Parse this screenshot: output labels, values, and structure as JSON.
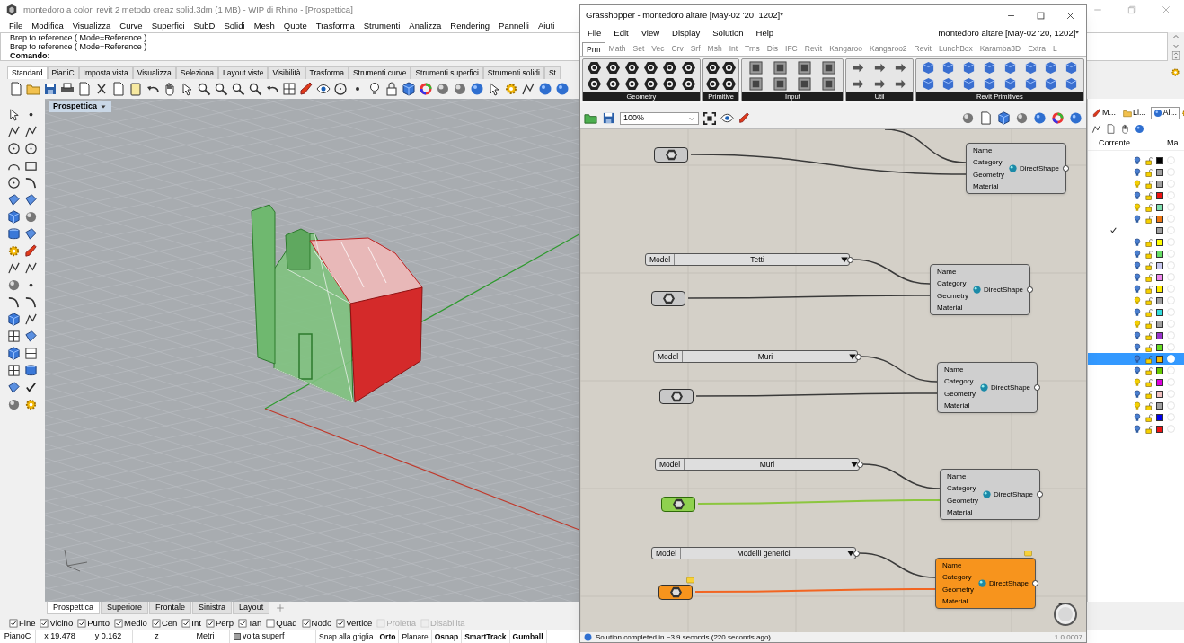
{
  "rhino": {
    "title": "montedoro a colori revit 2 metodo creaz solid.3dm (1 MB) - WIP di Rhino - [Prospettica]",
    "menu": [
      "File",
      "Modifica",
      "Visualizza",
      "Curve",
      "Superfici",
      "SubD",
      "Solidi",
      "Mesh",
      "Quote",
      "Trasforma",
      "Strumenti",
      "Analizza",
      "Rendering",
      "Pannelli",
      "Aiuti"
    ],
    "command_history": [
      "Brep to reference ( Mode=Reference )",
      "Brep to reference ( Mode=Reference )"
    ],
    "command_prompt": "Comando:",
    "toolbar_tabs": [
      {
        "label": "Standard",
        "selected": true
      },
      {
        "label": "PianiC",
        "selected": false
      },
      {
        "label": "Imposta vista",
        "selected": false
      },
      {
        "label": "Visualizza",
        "selected": false
      },
      {
        "label": "Seleziona",
        "selected": false
      },
      {
        "label": "Layout viste",
        "selected": false
      },
      {
        "label": "Visibilità",
        "selected": false
      },
      {
        "label": "Trasforma",
        "selected": false
      },
      {
        "label": "Strumenti curve",
        "selected": false
      },
      {
        "label": "Strumenti superfici",
        "selected": false
      },
      {
        "label": "Strumenti solidi",
        "selected": false
      },
      {
        "label": "St",
        "selected": false
      }
    ],
    "viewport": {
      "label": "Prospettica"
    },
    "viewport_tabs": [
      {
        "label": "Prospettica",
        "selected": true
      },
      {
        "label": "Superiore",
        "selected": false
      },
      {
        "label": "Frontale",
        "selected": false
      },
      {
        "label": "Sinistra",
        "selected": false
      },
      {
        "label": "Layout",
        "selected": false
      }
    ],
    "osnaps": [
      {
        "label": "Fine",
        "checked": true,
        "disabled": false
      },
      {
        "label": "Vicino",
        "checked": true,
        "disabled": false
      },
      {
        "label": "Punto",
        "checked": true,
        "disabled": false
      },
      {
        "label": "Medio",
        "checked": true,
        "disabled": false
      },
      {
        "label": "Cen",
        "checked": true,
        "disabled": false
      },
      {
        "label": "Int",
        "checked": true,
        "disabled": false
      },
      {
        "label": "Perp",
        "checked": true,
        "disabled": false
      },
      {
        "label": "Tan",
        "checked": true,
        "disabled": false
      },
      {
        "label": "Quad",
        "checked": false,
        "disabled": false
      },
      {
        "label": "Nodo",
        "checked": true,
        "disabled": false
      },
      {
        "label": "Vertice",
        "checked": true,
        "disabled": false
      },
      {
        "label": "Proietta",
        "checked": false,
        "disabled": true
      },
      {
        "label": "Disabilita",
        "checked": false,
        "disabled": true
      }
    ],
    "status_bar": [
      {
        "kind": "field",
        "label": "PianoC"
      },
      {
        "kind": "field",
        "label": "x 19.478"
      },
      {
        "kind": "field",
        "label": "y 0.162"
      },
      {
        "kind": "field",
        "label": "z"
      },
      {
        "kind": "field",
        "label": "Metri"
      },
      {
        "kind": "layer",
        "label": "volta superf"
      },
      {
        "kind": "toggle",
        "label": "Snap alla griglia",
        "on": false
      },
      {
        "kind": "toggle",
        "label": "Orto",
        "on": true
      },
      {
        "kind": "toggle",
        "label": "Planare",
        "on": false
      },
      {
        "kind": "toggle",
        "label": "Osnap",
        "on": true
      },
      {
        "kind": "toggle",
        "label": "SmartTrack",
        "on": true
      },
      {
        "kind": "toggle",
        "label": "Gumball",
        "on": true
      }
    ]
  },
  "grasshopper": {
    "title": "Grasshopper - montedoro altare [May-02 '20, 1202]*",
    "menu": [
      "File",
      "Edit",
      "View",
      "Display",
      "Solution",
      "Help"
    ],
    "document_name": "montedoro altare [May-02 '20, 1202]*",
    "tabs": [
      {
        "label": "Prm",
        "selected": true
      },
      {
        "label": "Math",
        "selected": false
      },
      {
        "label": "Set",
        "selected": false
      },
      {
        "label": "Vec",
        "selected": false
      },
      {
        "label": "Crv",
        "selected": false
      },
      {
        "label": "Srf",
        "selected": false
      },
      {
        "label": "Msh",
        "selected": false
      },
      {
        "label": "Int",
        "selected": false
      },
      {
        "label": "Trns",
        "selected": false
      },
      {
        "label": "Dis",
        "selected": false
      },
      {
        "label": "IFC",
        "selected": false
      },
      {
        "label": "Revit",
        "selected": false
      },
      {
        "label": "Kangaroo",
        "selected": false
      },
      {
        "label": "Kangaroo2",
        "selected": false
      },
      {
        "label": "Revit",
        "selected": false
      },
      {
        "label": "LunchBox",
        "selected": false
      },
      {
        "label": "Karamba3D",
        "selected": false
      },
      {
        "label": "Extra",
        "selected": false
      },
      {
        "label": "L",
        "selected": false
      }
    ],
    "ribbon_groups": [
      "Geometry",
      "Primitive",
      "Input",
      "Util",
      "Revit Primitives"
    ],
    "zoom": "100%",
    "components": [
      {
        "param": {
          "selected": false,
          "warning": false
        },
        "warning": false,
        "title": "DirectShape",
        "inputs": [
          "Name",
          "Category",
          "Geometry",
          "Material"
        ]
      },
      {
        "value_list": {
          "label": "Model",
          "value": "Tetti"
        },
        "param": {
          "selected": false,
          "warning": false
        },
        "warning": false,
        "title": "DirectShape",
        "inputs": [
          "Name",
          "Category",
          "Geometry",
          "Material"
        ]
      },
      {
        "value_list": {
          "label": "Model",
          "value": "Muri"
        },
        "param": {
          "selected": false,
          "warning": false
        },
        "warning": false,
        "title": "DirectShape",
        "inputs": [
          "Name",
          "Category",
          "Geometry",
          "Material"
        ]
      },
      {
        "value_list": {
          "label": "Model",
          "value": "Muri"
        },
        "param": {
          "selected": true,
          "warning": false
        },
        "warning": false,
        "title": "DirectShape",
        "inputs": [
          "Name",
          "Category",
          "Geometry",
          "Material"
        ]
      },
      {
        "value_list": {
          "label": "Model",
          "value": "Modelli generici"
        },
        "param": {
          "selected": false,
          "warning": true
        },
        "warning": true,
        "title": "DirectShape",
        "inputs": [
          "Name",
          "Category",
          "Geometry",
          "Material"
        ]
      }
    ],
    "status": "Solution completed in ~3.9 seconds (220 seconds ago)",
    "version": "1.0.0007"
  },
  "layers": {
    "tabs": [
      {
        "label": "M...",
        "selected": false
      },
      {
        "label": "Li...",
        "selected": false
      },
      {
        "label": "Ai...",
        "selected": true
      }
    ],
    "columns": [
      "Corrente",
      "Ma"
    ],
    "rows": [
      {
        "current": false,
        "lit": false,
        "color": "#000000",
        "selected": false
      },
      {
        "current": false,
        "lit": false,
        "color": "#a0a0a0",
        "selected": false
      },
      {
        "current": false,
        "lit": true,
        "color": "#a0a0a0",
        "selected": false
      },
      {
        "current": false,
        "lit": false,
        "color": "#ee1111",
        "selected": false
      },
      {
        "current": false,
        "lit": true,
        "color": "#80e0b0",
        "selected": false
      },
      {
        "current": false,
        "lit": false,
        "color": "#ee7711",
        "selected": false
      },
      {
        "current": true,
        "color": "#a0a0a0",
        "selected": false
      },
      {
        "current": false,
        "lit": false,
        "color": "#ffff00",
        "selected": false
      },
      {
        "current": false,
        "lit": false,
        "color": "#66dd66",
        "selected": false
      },
      {
        "current": false,
        "lit": false,
        "color": "#c8c8f0",
        "selected": false
      },
      {
        "current": false,
        "lit": false,
        "color": "#ee88ee",
        "selected": false
      },
      {
        "current": false,
        "lit": false,
        "color": "#ffee00",
        "selected": false
      },
      {
        "current": false,
        "lit": true,
        "color": "#a0a0a0",
        "selected": false
      },
      {
        "current": false,
        "lit": false,
        "color": "#33dddd",
        "selected": false
      },
      {
        "current": false,
        "lit": true,
        "color": "#a0a0a0",
        "selected": false
      },
      {
        "current": false,
        "lit": false,
        "color": "#9933cc",
        "selected": false
      },
      {
        "current": false,
        "lit": false,
        "color": "#66dd22",
        "selected": false
      },
      {
        "current": false,
        "lit": false,
        "color": "#f5b800",
        "selected": true
      },
      {
        "current": false,
        "lit": false,
        "color": "#66cc00",
        "selected": false
      },
      {
        "current": false,
        "lit": true,
        "color": "#dd00dd",
        "selected": false
      },
      {
        "current": false,
        "lit": false,
        "color": "#f0c0c0",
        "selected": false
      },
      {
        "current": false,
        "lit": true,
        "color": "#a0a0a0",
        "selected": false
      },
      {
        "current": false,
        "lit": false,
        "color": "#0000ee",
        "selected": false
      },
      {
        "current": false,
        "lit": false,
        "color": "#ee1111",
        "selected": false
      }
    ]
  }
}
